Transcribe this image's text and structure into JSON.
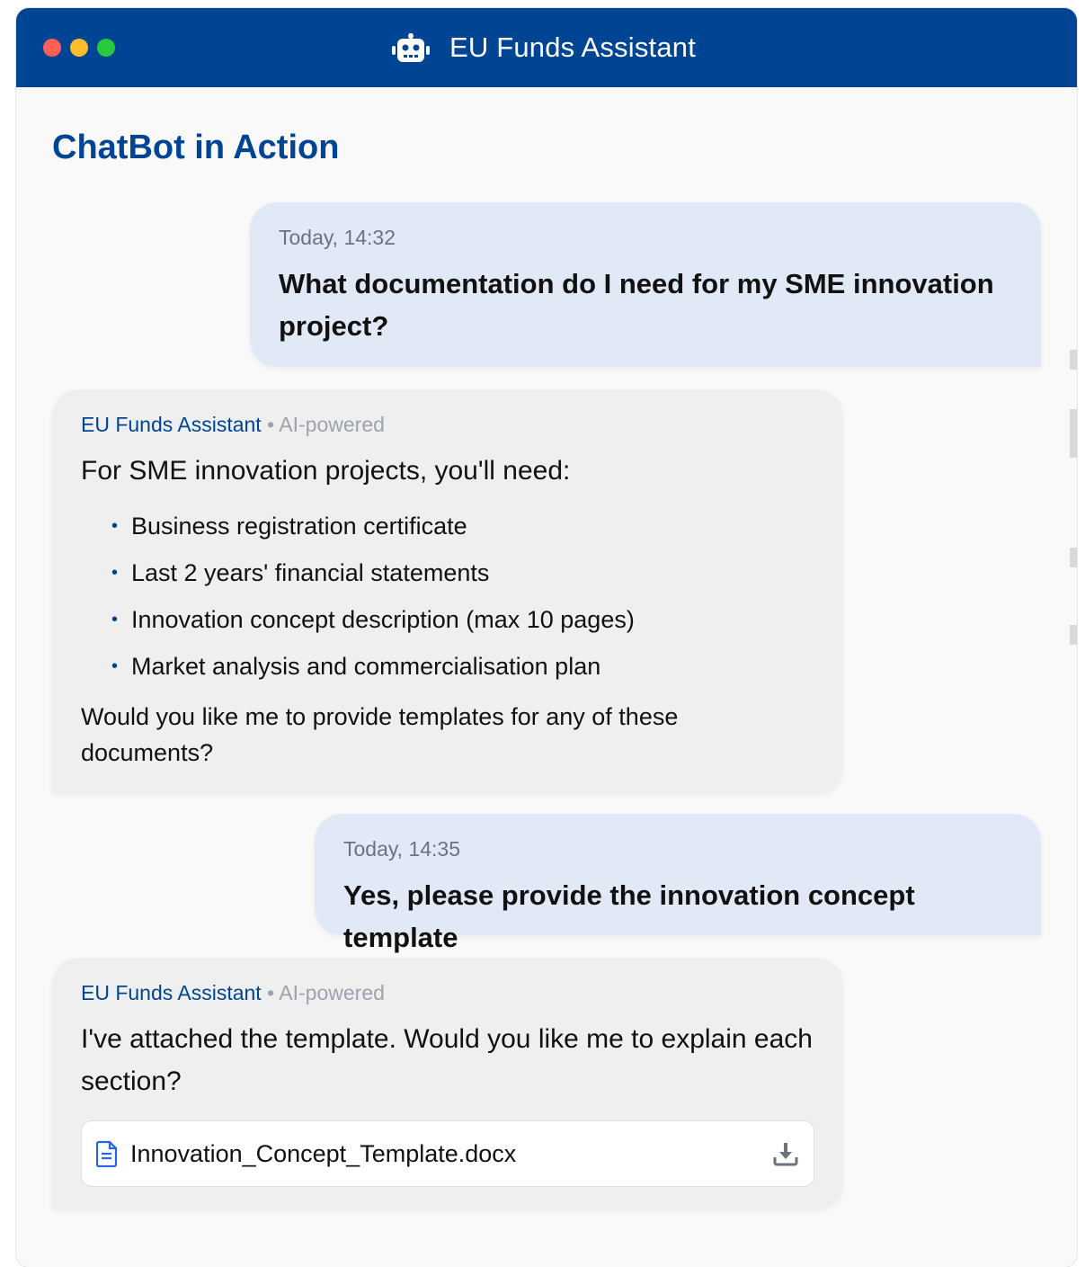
{
  "app": {
    "title": "EU Funds Assistant"
  },
  "page": {
    "heading": "ChatBot in Action"
  },
  "messages": {
    "m1": {
      "time": "Today, 14:32",
      "text": "What documentation do I need for my SME innovation project?"
    },
    "m2": {
      "sender": "EU Funds Assistant",
      "separator": "•",
      "tag": "AI-powered",
      "intro": "For SME innovation projects, you'll need:",
      "items": [
        "Business registration certificate",
        "Last 2 years' financial statements",
        "Innovation concept description (max 10 pages)",
        "Market analysis and commercialisation plan"
      ],
      "followup": "Would you like me to provide templates for any of these documents?"
    },
    "m3": {
      "time": "Today, 14:35",
      "text": "Yes, please provide the innovation concept template"
    },
    "m4": {
      "sender": "EU Funds Assistant",
      "separator": "•",
      "tag": "AI-powered",
      "text": "I've attached the template. Would you like me to explain each section?",
      "attachment": {
        "filename": "Innovation_Concept_Template.docx",
        "icon": "file-icon",
        "action_icon": "download-icon"
      }
    }
  },
  "colors": {
    "brand": "#004494",
    "user_bubble": "#e1e9f6",
    "bot_bubble": "#efefef",
    "traffic_red": "#ff5f56",
    "traffic_yellow": "#ffbd2e",
    "traffic_green": "#27c93f"
  },
  "icons": {
    "title_icon": "robot-icon"
  }
}
